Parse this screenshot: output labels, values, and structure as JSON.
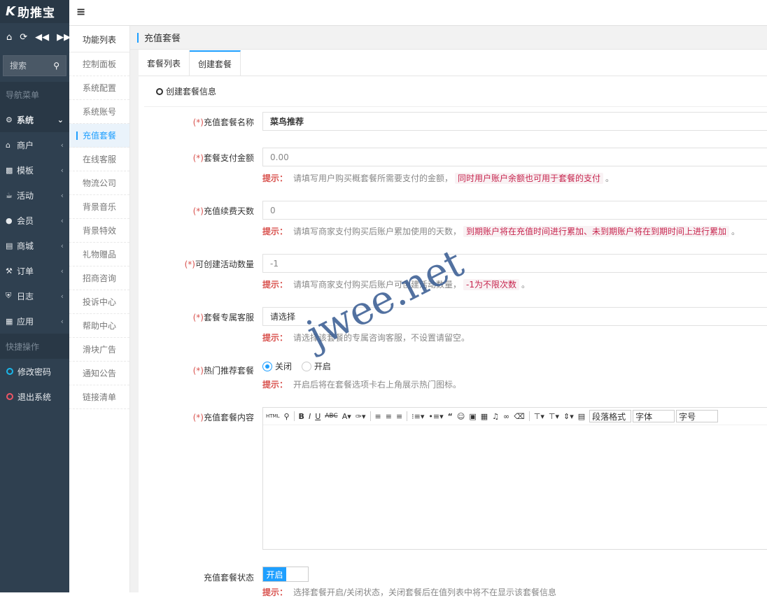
{
  "sidebar": {
    "logo": "助推宝",
    "logo_letter": "K",
    "search_placeholder": "搜索",
    "nav_heading": "导航菜单",
    "items": [
      {
        "label": "系统",
        "icon": "gear-icon"
      },
      {
        "label": "商户",
        "icon": "home-icon"
      },
      {
        "label": "模板",
        "icon": "sitemap-icon"
      },
      {
        "label": "活动",
        "icon": "trophy-icon"
      },
      {
        "label": "会员",
        "icon": "users-icon"
      },
      {
        "label": "商城",
        "icon": "cart-icon"
      },
      {
        "label": "订单",
        "icon": "gavel-icon"
      },
      {
        "label": "日志",
        "icon": "shield-icon"
      },
      {
        "label": "应用",
        "icon": "cubes-icon"
      }
    ],
    "quick_heading": "快捷操作",
    "quick_items": [
      {
        "label": "修改密码",
        "color": "#1ab7ea"
      },
      {
        "label": "退出系统",
        "color": "#ed5565"
      }
    ]
  },
  "subnav": {
    "heading": "功能列表",
    "items": [
      "控制面板",
      "系统配置",
      "系统账号",
      "充值套餐",
      "在线客服",
      "物流公司",
      "背景音乐",
      "背景特效",
      "礼物赠品",
      "招商咨询",
      "投诉中心",
      "帮助中心",
      "滑块广告",
      "通知公告",
      "链接清单"
    ]
  },
  "breadcrumb": "充值套餐",
  "tabs": [
    "套餐列表",
    "创建套餐"
  ],
  "legend": "创建套餐信息",
  "form": {
    "name": {
      "label": "充值套餐名称",
      "value": "菜鸟推荐"
    },
    "price": {
      "label": "套餐支付金额",
      "value": "0.00",
      "hint_key": "提示：",
      "hint": "请填写用户购买概套餐所需要支付的金额，",
      "hint_code": "同时用户账户余额也可用于套餐的支付",
      "hint_end": "。"
    },
    "days": {
      "label": "充值续费天数",
      "value": "0",
      "hint_key": "提示：",
      "hint": "请填写商家支付购买后账户累加使用的天数，",
      "hint_code": "到期账户将在充值时间进行累加、未到期账户将在到期时间上进行累加",
      "hint_end": "。"
    },
    "count": {
      "label": "可创建活动数量",
      "value": "-1",
      "hint_key": "提示：",
      "hint": "请填写商家支付购买后账户可创建活动数量，",
      "hint_code": "-1为不限次数",
      "hint_end": "。"
    },
    "service": {
      "label": "套餐专属客服",
      "value": "请选择",
      "hint_key": "提示：",
      "hint": "请选择该套餐的专属咨询客服，不设置请留空。"
    },
    "hot": {
      "label": "热门推荐套餐",
      "opt_off": "关闭",
      "opt_on": "开启",
      "hint_key": "提示：",
      "hint": "开启后将在套餐选项卡右上角展示热门图标。"
    },
    "content": {
      "label": "充值套餐内容",
      "toolbar": {
        "para": "段落格式",
        "font": "字体",
        "size": "字号"
      }
    },
    "status": {
      "label": "充值套餐状态",
      "toggle": "开启",
      "hint_key": "提示：",
      "hint": "选择套餐开启/关闭状态，关闭套餐后在值列表中将不在显示该套餐信息"
    }
  },
  "req_mark": "(*)",
  "watermark": "jwee.net"
}
